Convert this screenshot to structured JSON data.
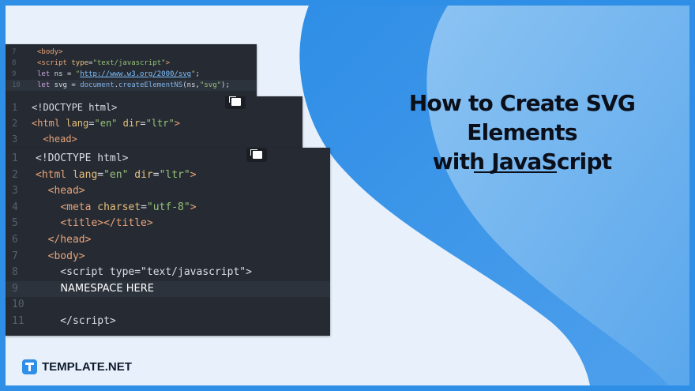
{
  "colors": {
    "frame": "#2f8ee6",
    "background": "#e8f1fb",
    "editor_bg": "#262b33",
    "title": "#0a0f1a"
  },
  "title": {
    "line1": "How to Create SVG Elements",
    "line2": "with JavaScript"
  },
  "brand": {
    "icon": "template-logo-icon",
    "name": "TEMPLATE.NET"
  },
  "panel_back": {
    "lines": [
      {
        "n": "7",
        "html": "<span class='tag'>&lt;body&gt;</span>"
      },
      {
        "n": "8",
        "html": "<span class='tag'>&lt;script</span> <span class='attr'>type</span>=<span class='str'>\"text/javascript\"</span><span class='tag'>&gt;</span>"
      },
      {
        "n": "9",
        "html": "<span class='kw'>let</span> ns = <span class='str'>\"</span><span class='url'>http://www.w3.org/2000/svg</span><span class='str'>\"</span>;"
      },
      {
        "n": "10",
        "html": "<span class='kw'>let</span> svg = <span class='fn'>document</span>.<span class='fn'>createElementNS</span>(ns,<span class='str'>\"svg\"</span>);"
      }
    ]
  },
  "panel_mid": {
    "lines": [
      {
        "n": "1",
        "html": "&lt;!DOCTYPE html&gt;"
      },
      {
        "n": "2",
        "html": "<span class='tag'>&lt;html</span> <span class='attr'>lang</span>=<span class='str'>\"en\"</span> <span class='attr'>dir</span>=<span class='str'>\"ltr\"</span><span class='tag'>&gt;</span>"
      },
      {
        "n": "3",
        "html": "  <span class='tag'>&lt;head&gt;</span>"
      }
    ]
  },
  "panel_front": {
    "lines": [
      {
        "n": "1",
        "html": "&lt;!DOCTYPE html&gt;"
      },
      {
        "n": "2",
        "html": "<span class='tag'>&lt;html</span> <span class='attr'>lang</span>=<span class='str'>\"en\"</span> <span class='attr'>dir</span>=<span class='str'>\"ltr\"</span><span class='tag'>&gt;</span>"
      },
      {
        "n": "3",
        "html": "  <span class='tag'>&lt;head&gt;</span>"
      },
      {
        "n": "4",
        "html": "    <span class='tag'>&lt;meta</span> <span class='attr'>charset</span>=<span class='str'>\"utf-8\"</span><span class='tag'>&gt;</span>"
      },
      {
        "n": "5",
        "html": "    <span class='tag'>&lt;title&gt;&lt;/title&gt;</span>"
      },
      {
        "n": "6",
        "html": "  <span class='tag'>&lt;/head&gt;</span>"
      },
      {
        "n": "7",
        "html": "  <span class='tag'>&lt;body&gt;</span>"
      },
      {
        "n": "8",
        "html": "    &lt;script type=\"text/javascript\"&gt;"
      },
      {
        "n": "9",
        "html": "    <span style='color:#ffffff;font-family:\"DejaVu Sans\",sans-serif'>NAMESPACE HERE</span>"
      },
      {
        "n": "10",
        "html": ""
      },
      {
        "n": "11",
        "html": "    &lt;/script&gt;"
      }
    ]
  }
}
